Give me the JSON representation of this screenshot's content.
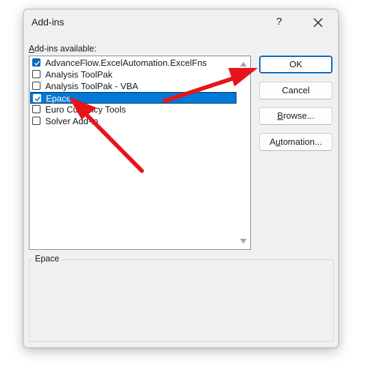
{
  "dialog": {
    "title": "Add-ins",
    "help_label": "?",
    "close_icon": "close-icon"
  },
  "list": {
    "label_prefix": "",
    "label_accesskey": "A",
    "label_rest": "dd-ins available:",
    "items": [
      {
        "label": "AdvanceFlow.ExcelAutomation.ExcelFns",
        "checked": true,
        "selected": false
      },
      {
        "label": "Analysis ToolPak",
        "checked": false,
        "selected": false
      },
      {
        "label": "Analysis ToolPak - VBA",
        "checked": false,
        "selected": false
      },
      {
        "label": "Epace",
        "checked": true,
        "selected": true
      },
      {
        "label": "Euro Currency Tools",
        "checked": false,
        "selected": false
      },
      {
        "label": "Solver Add-in",
        "checked": false,
        "selected": false
      }
    ]
  },
  "buttons": {
    "ok": {
      "label": "OK",
      "accesskey": "",
      "rest": "OK"
    },
    "cancel": {
      "label": "Cancel"
    },
    "browse": {
      "accesskey": "B",
      "rest": "rowse..."
    },
    "automation": {
      "accesskey": "u",
      "pre": "A",
      "rest": "tomation..."
    }
  },
  "description": {
    "title": "Epace",
    "text": ""
  },
  "colors": {
    "selection": "#0078d7",
    "checkbox_checked": "#0067c0",
    "annotation_arrow": "#e8141b"
  }
}
